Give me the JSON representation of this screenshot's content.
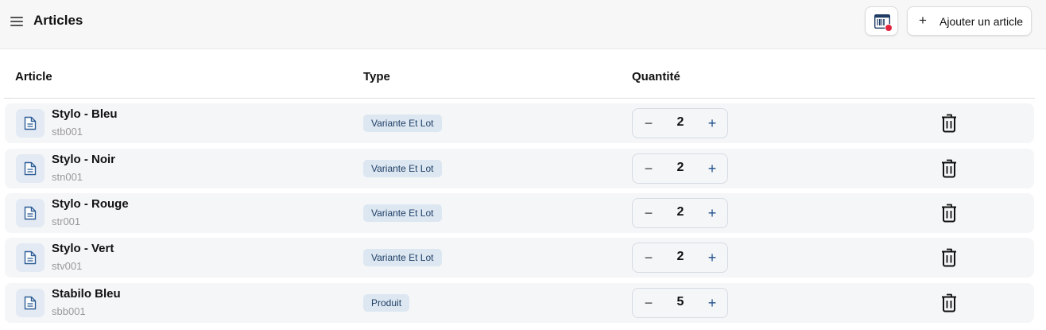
{
  "header": {
    "title": "Articles",
    "menu_icon": "hamburger-menu-icon",
    "scan_icon": "barcode-scan-icon",
    "add_button": {
      "icon": "plus",
      "label": "Ajouter un article"
    }
  },
  "table": {
    "columns": [
      "Article",
      "Type",
      "Quantité"
    ],
    "rows": [
      {
        "name": "Stylo - Bleu",
        "code": "stb001",
        "type": "Variante Et Lot",
        "quantity": "2"
      },
      {
        "name": "Stylo - Noir",
        "code": "stn001",
        "type": "Variante Et Lot",
        "quantity": "2"
      },
      {
        "name": "Stylo - Rouge",
        "code": "str001",
        "type": "Variante Et Lot",
        "quantity": "2"
      },
      {
        "name": "Stylo - Vert",
        "code": "stv001",
        "type": "Variante Et Lot",
        "quantity": "2"
      },
      {
        "name": "Stabilo Bleu",
        "code": "sbb001",
        "type": "Produit",
        "quantity": "5"
      }
    ],
    "stepper": {
      "minus": "−",
      "plus": "+"
    },
    "row_icons": {
      "article": "document-icon",
      "delete": "trash-icon"
    }
  },
  "colors": {
    "accent": "#1e4f8a",
    "badge_bg": "#dde7f1",
    "notification_dot": "#e0223a",
    "row_bg": "#f5f6f8"
  }
}
